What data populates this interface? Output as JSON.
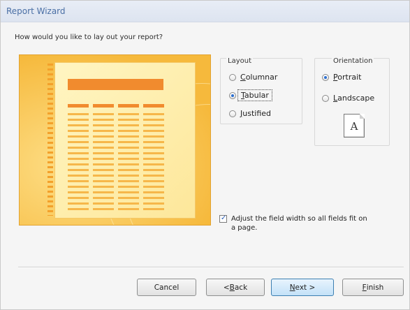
{
  "window": {
    "title": "Report Wizard"
  },
  "prompt": "How would you like to lay out your report?",
  "layout": {
    "legend": "Layout",
    "options": [
      {
        "label": "Columnar",
        "selected": false,
        "mnemonic": "C"
      },
      {
        "label": "Tabular",
        "selected": true,
        "mnemonic": "T"
      },
      {
        "label": "Justified",
        "selected": false,
        "mnemonic": "J"
      }
    ]
  },
  "orientation": {
    "legend": "Orientation",
    "options": [
      {
        "label": "Portrait",
        "selected": true,
        "mnemonic": "P"
      },
      {
        "label": "Landscape",
        "selected": false,
        "mnemonic": "L"
      }
    ],
    "icon_letter": "A"
  },
  "adjust_width": {
    "label_line1": "Adjust the field width so all fields fit on",
    "label_line2": "a page.",
    "checked": true
  },
  "buttons": {
    "cancel": "Cancel",
    "back": "< Back",
    "next": "Next >",
    "finish": "Finish"
  },
  "colors": {
    "preview_bg": "#f6b93c",
    "accent_orange": "#f18b2e",
    "title_blue": "#4a6fa5",
    "radio_selected": "#2c6fd0"
  }
}
